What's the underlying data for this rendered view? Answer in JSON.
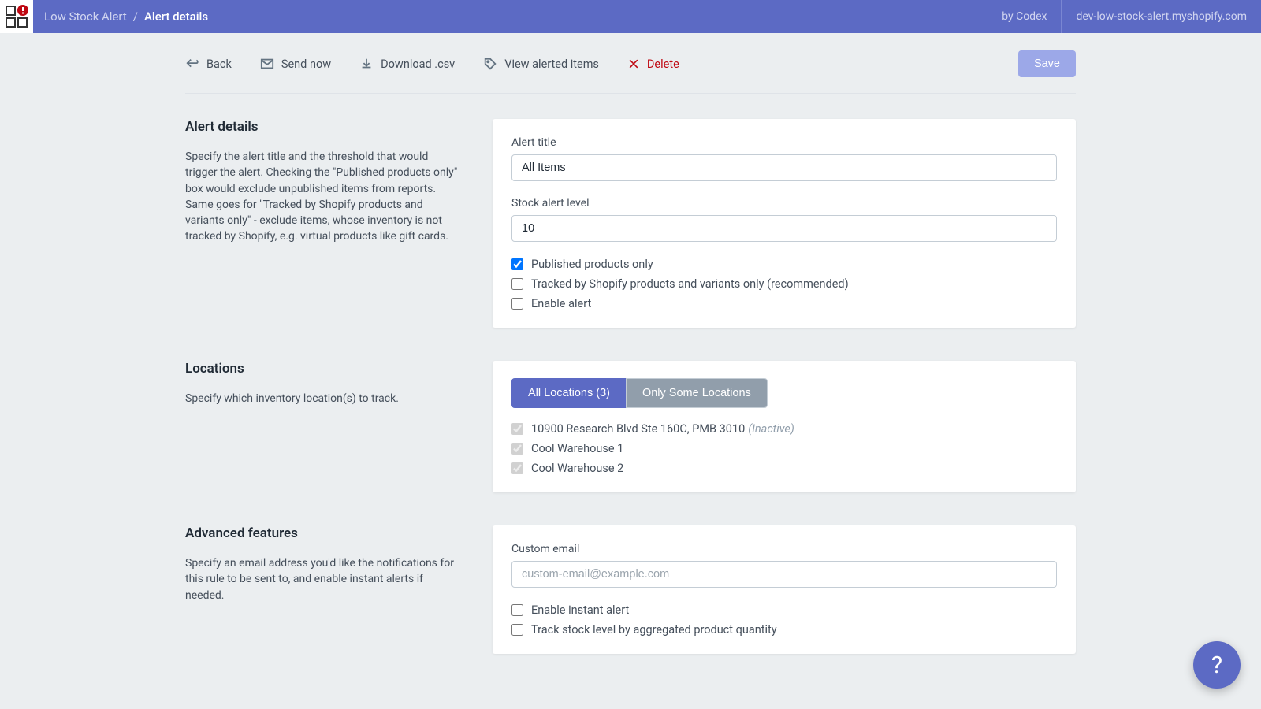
{
  "topbar": {
    "breadcrumb_root": "Low Stock Alert",
    "breadcrumb_sep": "/",
    "breadcrumb_current": "Alert details",
    "by": "by Codex",
    "shop": "dev-low-stock-alert.myshopify.com"
  },
  "toolbar": {
    "back": "Back",
    "send_now": "Send now",
    "download_csv": "Download .csv",
    "view_alerted": "View alerted items",
    "delete": "Delete",
    "save": "Save"
  },
  "sections": {
    "alert_details": {
      "title": "Alert details",
      "desc": "Specify the alert title and the threshold that would trigger the alert. Checking the \"Published products only\" box would exclude unpublished items from reports. Same goes for \"Tracked by Shopify products and variants only\" - exclude items, whose inventory is not tracked by Shopify, e.g. virtual products like gift cards.",
      "fields": {
        "title_label": "Alert title",
        "title_value": "All Items",
        "level_label": "Stock alert level",
        "level_value": "10",
        "published_only": "Published products only",
        "tracked_only": "Tracked by Shopify products and variants only (recommended)",
        "enable_alert": "Enable alert"
      }
    },
    "locations": {
      "title": "Locations",
      "desc": "Specify which inventory location(s) to track.",
      "tab_all": "All Locations (3)",
      "tab_some": "Only Some Locations",
      "items": [
        {
          "label": "10900 Research Blvd Ste 160C, PMB 3010",
          "inactive": "(Inactive)"
        },
        {
          "label": "Cool Warehouse 1",
          "inactive": ""
        },
        {
          "label": "Cool Warehouse 2",
          "inactive": ""
        }
      ]
    },
    "advanced": {
      "title": "Advanced features",
      "desc": "Specify an email address you'd like the notifications for this rule to be sent to, and enable instant alerts if needed.",
      "email_label": "Custom email",
      "email_placeholder": "custom-email@example.com",
      "instant": "Enable instant alert",
      "aggregated": "Track stock level by aggregated product quantity"
    }
  },
  "help": "?"
}
